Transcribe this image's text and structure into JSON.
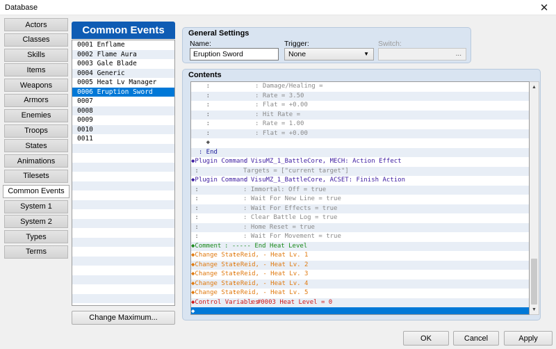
{
  "window": {
    "title": "Database",
    "close_glyph": "✕"
  },
  "tabs": [
    {
      "label": "Actors"
    },
    {
      "label": "Classes"
    },
    {
      "label": "Skills"
    },
    {
      "label": "Items"
    },
    {
      "label": "Weapons"
    },
    {
      "label": "Armors"
    },
    {
      "label": "Enemies"
    },
    {
      "label": "Troops"
    },
    {
      "label": "States"
    },
    {
      "label": "Animations"
    },
    {
      "label": "Tilesets"
    },
    {
      "label": "Common Events",
      "active": true
    },
    {
      "label": "System 1"
    },
    {
      "label": "System 2"
    },
    {
      "label": "Types"
    },
    {
      "label": "Terms"
    }
  ],
  "events_panel": {
    "title": "Common Events",
    "items": [
      "0001 Enflame",
      "0002 Flame Aura",
      "0003 Gale Blade",
      "0004 Generic",
      "0005 Heat Lv Manager",
      "0006 Eruption Sword",
      "0007",
      "0008",
      "0009",
      "0010",
      "0011"
    ],
    "selected_index": 5,
    "total_rows": 28,
    "change_max_label": "Change Maximum..."
  },
  "general": {
    "title": "General Settings",
    "name_label": "Name:",
    "name_value": "Eruption Sword",
    "trigger_label": "Trigger:",
    "trigger_value": "None",
    "switch_label": "Switch:",
    "switch_button": "..."
  },
  "contents": {
    "title": "Contents",
    "colors": {
      "purple": "#3b1aa0",
      "grey": "#8a8a8a",
      "green": "#1a8a1a",
      "orange": "#e07a10",
      "red": "#d01818",
      "navy": "#1a1a9a"
    },
    "rows": [
      {
        "lead": "    :",
        "body": ": Damage/Healing =",
        "indent": 92,
        "color": "grey"
      },
      {
        "lead": "    :",
        "body": ": Rate = 3.50",
        "indent": 92,
        "color": "grey"
      },
      {
        "lead": "    :",
        "body": ": Flat = +0.00",
        "indent": 92,
        "color": "grey"
      },
      {
        "lead": "    :",
        "body": ": Hit Rate =",
        "indent": 92,
        "color": "grey"
      },
      {
        "lead": "    :",
        "body": ": Rate = 1.00",
        "indent": 92,
        "color": "grey"
      },
      {
        "lead": "    :",
        "body": ": Flat = +0.00",
        "indent": 92,
        "color": "grey"
      },
      {
        "lead": "    ◆",
        "body": "",
        "indent": 92,
        "color": "grey"
      },
      {
        "lead": "  : End",
        "body": "",
        "indent": 0,
        "color": "navy"
      },
      {
        "lead": "◆Plugin Command",
        "body": ": VisuMZ_1_BattleCore, MECH: Action Effect",
        "indent": 75,
        "color": "purple"
      },
      {
        "lead": " :",
        "body": "Targets = [\"current target\"]",
        "indent": 75,
        "color": "grey"
      },
      {
        "lead": "◆Plugin Command",
        "body": ": VisuMZ_1_BattleCore, ACSET: Finish Action",
        "indent": 75,
        "color": "purple"
      },
      {
        "lead": " :",
        "body": ": Immortal: Off = true",
        "indent": 75,
        "color": "grey"
      },
      {
        "lead": " :",
        "body": ": Wait For New Line = true",
        "indent": 75,
        "color": "grey"
      },
      {
        "lead": " :",
        "body": ": Wait For Effects = true",
        "indent": 75,
        "color": "grey"
      },
      {
        "lead": " :",
        "body": ": Clear Battle Log = true",
        "indent": 75,
        "color": "grey"
      },
      {
        "lead": " :",
        "body": ": Home Reset = true",
        "indent": 75,
        "color": "grey"
      },
      {
        "lead": " :",
        "body": ": Wait For Movement = true",
        "indent": 75,
        "color": "grey"
      },
      {
        "lead": "◆Comment",
        "body": ": ----- End Heat Level",
        "indent": 48,
        "color": "green"
      },
      {
        "lead": "◆Change State",
        "body": ": Reid, - Heat Lv. 1",
        "indent": 60,
        "color": "orange"
      },
      {
        "lead": "◆Change State",
        "body": ": Reid, - Heat Lv. 2",
        "indent": 60,
        "color": "orange"
      },
      {
        "lead": "◆Change State",
        "body": ": Reid, - Heat Lv. 3",
        "indent": 60,
        "color": "orange"
      },
      {
        "lead": "◆Change State",
        "body": ": Reid, - Heat Lv. 4",
        "indent": 60,
        "color": "orange"
      },
      {
        "lead": "◆Change State",
        "body": ": Reid, - Heat Lv. 5",
        "indent": 60,
        "color": "orange"
      },
      {
        "lead": "◆Control Variables",
        "body": ": #0003 Heat Level = 0",
        "indent": 84,
        "color": "red"
      },
      {
        "lead": "◆",
        "body": "",
        "indent": 0,
        "color": "grey",
        "selected": true
      }
    ]
  },
  "footer": {
    "ok": "OK",
    "cancel": "Cancel",
    "apply": "Apply"
  }
}
